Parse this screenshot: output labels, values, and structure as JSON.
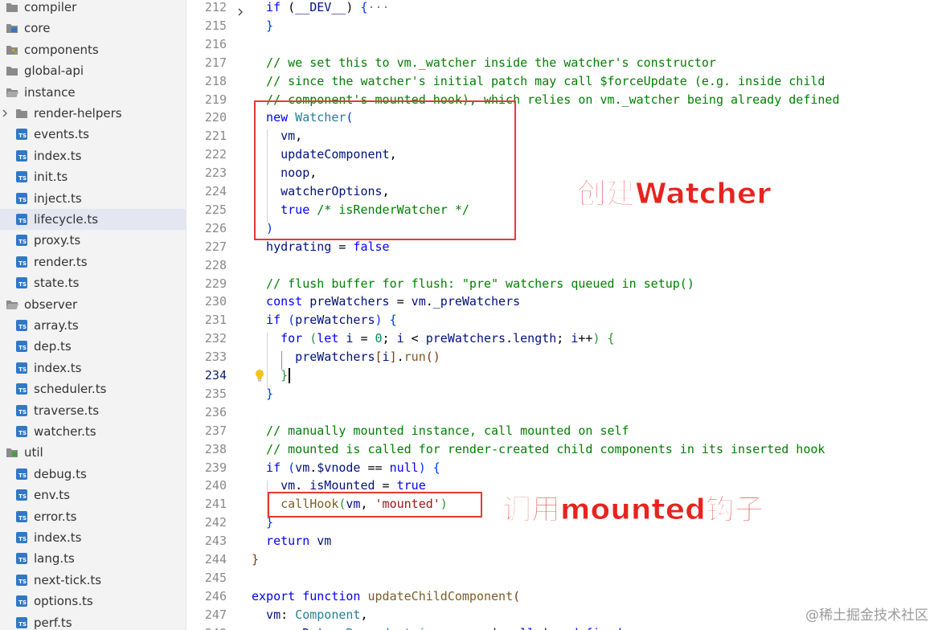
{
  "explorer": {
    "items": [
      {
        "label": "compiler",
        "kind": "folder",
        "icon": "folder-icon",
        "indent": 0,
        "expanded": false,
        "chevron": false
      },
      {
        "label": "core",
        "kind": "folder",
        "icon": "folder-core-icon",
        "indent": 0,
        "expanded": true,
        "chevron": false
      },
      {
        "label": "components",
        "kind": "folder",
        "icon": "folder-components-icon",
        "indent": 0,
        "expanded": false,
        "chevron": false
      },
      {
        "label": "global-api",
        "kind": "folder",
        "icon": "folder-icon",
        "indent": 0,
        "expanded": false,
        "chevron": false
      },
      {
        "label": "instance",
        "kind": "folder",
        "icon": "folder-open-icon",
        "indent": 0,
        "expanded": true,
        "chevron": false
      },
      {
        "label": "render-helpers",
        "kind": "folder",
        "icon": "folder-icon",
        "indent": 1,
        "expanded": false,
        "chevron": true
      },
      {
        "label": "events.ts",
        "kind": "file",
        "icon": "typescript-file-icon",
        "indent": 1
      },
      {
        "label": "index.ts",
        "kind": "file",
        "icon": "typescript-file-icon",
        "indent": 1
      },
      {
        "label": "init.ts",
        "kind": "file",
        "icon": "typescript-file-icon",
        "indent": 1
      },
      {
        "label": "inject.ts",
        "kind": "file",
        "icon": "typescript-file-icon",
        "indent": 1
      },
      {
        "label": "lifecycle.ts",
        "kind": "file",
        "icon": "typescript-file-icon",
        "indent": 1,
        "active": true
      },
      {
        "label": "proxy.ts",
        "kind": "file",
        "icon": "typescript-file-icon",
        "indent": 1
      },
      {
        "label": "render.ts",
        "kind": "file",
        "icon": "typescript-file-icon",
        "indent": 1
      },
      {
        "label": "state.ts",
        "kind": "file",
        "icon": "typescript-file-icon",
        "indent": 1
      },
      {
        "label": "observer",
        "kind": "folder",
        "icon": "folder-open-icon",
        "indent": 0,
        "expanded": true,
        "chevron": false
      },
      {
        "label": "array.ts",
        "kind": "file",
        "icon": "typescript-file-icon",
        "indent": 1
      },
      {
        "label": "dep.ts",
        "kind": "file",
        "icon": "typescript-file-icon",
        "indent": 1
      },
      {
        "label": "index.ts",
        "kind": "file",
        "icon": "typescript-file-icon",
        "indent": 1
      },
      {
        "label": "scheduler.ts",
        "kind": "file",
        "icon": "typescript-file-icon",
        "indent": 1
      },
      {
        "label": "traverse.ts",
        "kind": "file",
        "icon": "typescript-file-icon",
        "indent": 1
      },
      {
        "label": "watcher.ts",
        "kind": "file",
        "icon": "typescript-file-icon",
        "indent": 1
      },
      {
        "label": "util",
        "kind": "folder",
        "icon": "folder-util-icon",
        "indent": 0,
        "expanded": true,
        "chevron": false
      },
      {
        "label": "debug.ts",
        "kind": "file",
        "icon": "typescript-file-icon",
        "indent": 1
      },
      {
        "label": "env.ts",
        "kind": "file",
        "icon": "typescript-file-icon",
        "indent": 1
      },
      {
        "label": "error.ts",
        "kind": "file",
        "icon": "typescript-file-icon",
        "indent": 1
      },
      {
        "label": "index.ts",
        "kind": "file",
        "icon": "typescript-file-icon",
        "indent": 1
      },
      {
        "label": "lang.ts",
        "kind": "file",
        "icon": "typescript-file-icon",
        "indent": 1
      },
      {
        "label": "next-tick.ts",
        "kind": "file",
        "icon": "typescript-file-icon",
        "indent": 1
      },
      {
        "label": "options.ts",
        "kind": "file",
        "icon": "typescript-file-icon",
        "indent": 1
      },
      {
        "label": "perf.ts",
        "kind": "file",
        "icon": "typescript-file-icon",
        "indent": 1
      }
    ]
  },
  "editor": {
    "current_line": 234,
    "lines": [
      {
        "n": "212",
        "folded": true,
        "tokens": [
          [
            "kw",
            "if"
          ],
          [
            "op",
            " ("
          ],
          [
            "var",
            "__DEV__"
          ],
          [
            "op",
            ") "
          ],
          [
            "b1",
            "{"
          ],
          [
            "fold",
            "···"
          ]
        ]
      },
      {
        "n": "215",
        "tokens": [
          [
            "b1",
            "}"
          ]
        ]
      },
      {
        "n": "216",
        "tokens": []
      },
      {
        "n": "217",
        "tokens": [
          [
            "cm",
            "// we set this to vm._watcher inside the watcher's constructor"
          ]
        ]
      },
      {
        "n": "218",
        "tokens": [
          [
            "cm",
            "// since the watcher's initial patch may call $forceUpdate (e.g. inside child"
          ]
        ]
      },
      {
        "n": "219",
        "tokens": [
          [
            "cm",
            "// component's mounted hook), which relies on vm._watcher being already defined"
          ]
        ]
      },
      {
        "n": "220",
        "tokens": [
          [
            "kw",
            "new "
          ],
          [
            "cls",
            "Watcher"
          ],
          [
            "b1",
            "("
          ]
        ]
      },
      {
        "n": "221",
        "indent": 1,
        "tokens": [
          [
            "var",
            "vm"
          ],
          [
            "op",
            ","
          ]
        ]
      },
      {
        "n": "222",
        "indent": 1,
        "tokens": [
          [
            "var",
            "updateComponent"
          ],
          [
            "op",
            ","
          ]
        ]
      },
      {
        "n": "223",
        "indent": 1,
        "tokens": [
          [
            "var",
            "noop"
          ],
          [
            "op",
            ","
          ]
        ]
      },
      {
        "n": "224",
        "indent": 1,
        "tokens": [
          [
            "var",
            "watcherOptions"
          ],
          [
            "op",
            ","
          ]
        ]
      },
      {
        "n": "225",
        "indent": 1,
        "tokens": [
          [
            "kw",
            "true"
          ],
          [
            "op",
            " "
          ],
          [
            "cm",
            "/* isRenderWatcher */"
          ]
        ]
      },
      {
        "n": "226",
        "tokens": [
          [
            "b1",
            ")"
          ]
        ]
      },
      {
        "n": "227",
        "tokens": [
          [
            "var",
            "hydrating"
          ],
          [
            "op",
            " = "
          ],
          [
            "kw",
            "false"
          ]
        ]
      },
      {
        "n": "228",
        "tokens": []
      },
      {
        "n": "229",
        "tokens": [
          [
            "cm",
            "// flush buffer for flush: \"pre\" watchers queued in setup()"
          ]
        ]
      },
      {
        "n": "230",
        "tokens": [
          [
            "kw",
            "const "
          ],
          [
            "var",
            "preWatchers"
          ],
          [
            "op",
            " = "
          ],
          [
            "var",
            "vm"
          ],
          [
            "op",
            "."
          ],
          [
            "var",
            "_preWatchers"
          ]
        ]
      },
      {
        "n": "231",
        "tokens": [
          [
            "kw",
            "if"
          ],
          [
            "op",
            " "
          ],
          [
            "b1",
            "("
          ],
          [
            "var",
            "preWatchers"
          ],
          [
            "b1",
            ")"
          ],
          [
            "op",
            " "
          ],
          [
            "b1",
            "{"
          ]
        ]
      },
      {
        "n": "232",
        "indent": 1,
        "tokens": [
          [
            "kw",
            "for"
          ],
          [
            "op",
            " "
          ],
          [
            "b2",
            "("
          ],
          [
            "kw",
            "let "
          ],
          [
            "var",
            "i"
          ],
          [
            "op",
            " = "
          ],
          [
            "num",
            "0"
          ],
          [
            "op",
            "; "
          ],
          [
            "var",
            "i"
          ],
          [
            "op",
            " < "
          ],
          [
            "var",
            "preWatchers"
          ],
          [
            "op",
            "."
          ],
          [
            "var",
            "length"
          ],
          [
            "op",
            "; "
          ],
          [
            "var",
            "i"
          ],
          [
            "op",
            "++"
          ],
          [
            "b2",
            ")"
          ],
          [
            "op",
            " "
          ],
          [
            "b2",
            "{"
          ]
        ]
      },
      {
        "n": "233",
        "indent": 2,
        "tokens": [
          [
            "var",
            "preWatchers"
          ],
          [
            "b3",
            "["
          ],
          [
            "var",
            "i"
          ],
          [
            "b3",
            "]"
          ],
          [
            "op",
            "."
          ],
          [
            "fn",
            "run"
          ],
          [
            "b3",
            "()"
          ]
        ]
      },
      {
        "n": "234",
        "indent": 1,
        "tokens": [
          [
            "b2",
            "}"
          ]
        ]
      },
      {
        "n": "235",
        "tokens": [
          [
            "b1",
            "}"
          ]
        ]
      },
      {
        "n": "236",
        "tokens": []
      },
      {
        "n": "237",
        "tokens": [
          [
            "cm",
            "// manually mounted instance, call mounted on self"
          ]
        ]
      },
      {
        "n": "238",
        "tokens": [
          [
            "cm",
            "// mounted is called for render-created child components in its inserted hook"
          ]
        ]
      },
      {
        "n": "239",
        "tokens": [
          [
            "kw",
            "if"
          ],
          [
            "op",
            " "
          ],
          [
            "b1",
            "("
          ],
          [
            "var",
            "vm"
          ],
          [
            "op",
            "."
          ],
          [
            "var",
            "$vnode"
          ],
          [
            "op",
            " == "
          ],
          [
            "kw",
            "null"
          ],
          [
            "b1",
            ")"
          ],
          [
            "op",
            " "
          ],
          [
            "b1",
            "{"
          ]
        ]
      },
      {
        "n": "240",
        "indent": 1,
        "tokens": [
          [
            "var",
            "vm"
          ],
          [
            "op",
            "."
          ],
          [
            "var",
            "_isMounted"
          ],
          [
            "op",
            " = "
          ],
          [
            "kw",
            "true"
          ]
        ]
      },
      {
        "n": "241",
        "indent": 1,
        "tokens": [
          [
            "fn",
            "callHook"
          ],
          [
            "b2",
            "("
          ],
          [
            "var",
            "vm"
          ],
          [
            "op",
            ", "
          ],
          [
            "str",
            "'mounted'"
          ],
          [
            "b2",
            ")"
          ]
        ]
      },
      {
        "n": "242",
        "tokens": [
          [
            "b1",
            "}"
          ]
        ]
      },
      {
        "n": "243",
        "tokens": [
          [
            "kw",
            "return "
          ],
          [
            "var",
            "vm"
          ]
        ]
      },
      {
        "n": "244",
        "base": 0,
        "tokens": [
          [
            "b3",
            "}"
          ]
        ]
      },
      {
        "n": "245",
        "tokens": []
      },
      {
        "n": "246",
        "base": 0,
        "tokens": [
          [
            "kw",
            "export function "
          ],
          [
            "fn",
            "updateChildComponent"
          ],
          [
            "b3",
            "("
          ]
        ]
      },
      {
        "n": "247",
        "tokens": [
          [
            "var",
            "vm"
          ],
          [
            "op",
            ": "
          ],
          [
            "cls",
            "Component"
          ],
          [
            "op",
            ","
          ]
        ]
      },
      {
        "n": "248",
        "tokens": [
          [
            "var",
            "propsData"
          ],
          [
            "op",
            ": "
          ],
          [
            "cls",
            "Record"
          ],
          [
            "op",
            "<"
          ],
          [
            "cls",
            "string"
          ],
          [
            "op",
            ", "
          ],
          [
            "cls",
            "any"
          ],
          [
            "op",
            "> | "
          ],
          [
            "kw",
            "null"
          ],
          [
            "op",
            " | "
          ],
          [
            "kw",
            "undefined"
          ]
        ]
      }
    ]
  },
  "annotations": {
    "create_watcher": "创建Watcher",
    "call_mounted_hook": "调用mounted钩子",
    "color": "#e53935"
  },
  "watermark": "@稀土掘金技术社区"
}
